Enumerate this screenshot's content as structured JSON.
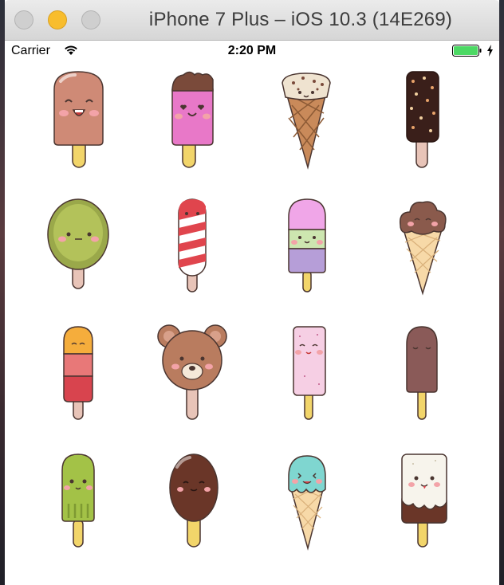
{
  "window": {
    "title": "iPhone 7 Plus – iOS 10.3 (14E269)"
  },
  "status_bar": {
    "carrier": "Carrier",
    "time": "2:20 PM",
    "wifi_icon": "wifi-icon",
    "battery_icon": "battery-icon",
    "charging_icon": "charging-bolt-icon",
    "battery_color": "#4cd964"
  },
  "colors": {
    "outline": "#4a3530",
    "stick": "#f2d56a",
    "stick_wood": "#e8c4b8",
    "cheek": "#f3a3a8"
  },
  "ice_creams": [
    {
      "name": "chocolate-popsicle-icon",
      "row": 1,
      "col": 1
    },
    {
      "name": "strawberry-bitten-popsicle-icon",
      "row": 1,
      "col": 2
    },
    {
      "name": "nut-cone-icon",
      "row": 1,
      "col": 3
    },
    {
      "name": "chocolate-nut-bar-icon",
      "row": 1,
      "col": 4
    },
    {
      "name": "green-round-popsicle-icon",
      "row": 2,
      "col": 1
    },
    {
      "name": "striped-popsicle-icon",
      "row": 2,
      "col": 2
    },
    {
      "name": "tricolor-popsicle-icon",
      "row": 2,
      "col": 3
    },
    {
      "name": "chocolate-cone-icon",
      "row": 2,
      "col": 4
    },
    {
      "name": "orange-red-popsicle-icon",
      "row": 3,
      "col": 1
    },
    {
      "name": "teddy-bear-popsicle-icon",
      "row": 3,
      "col": 2
    },
    {
      "name": "pink-speckled-bar-icon",
      "row": 3,
      "col": 3
    },
    {
      "name": "chocolate-bar-icon",
      "row": 3,
      "col": 4
    },
    {
      "name": "green-ribbed-popsicle-icon",
      "row": 4,
      "col": 1
    },
    {
      "name": "chocolate-oval-popsicle-icon",
      "row": 4,
      "col": 2
    },
    {
      "name": "mint-cone-icon",
      "row": 4,
      "col": 3
    },
    {
      "name": "vanilla-chocolate-bar-icon",
      "row": 4,
      "col": 4
    }
  ]
}
